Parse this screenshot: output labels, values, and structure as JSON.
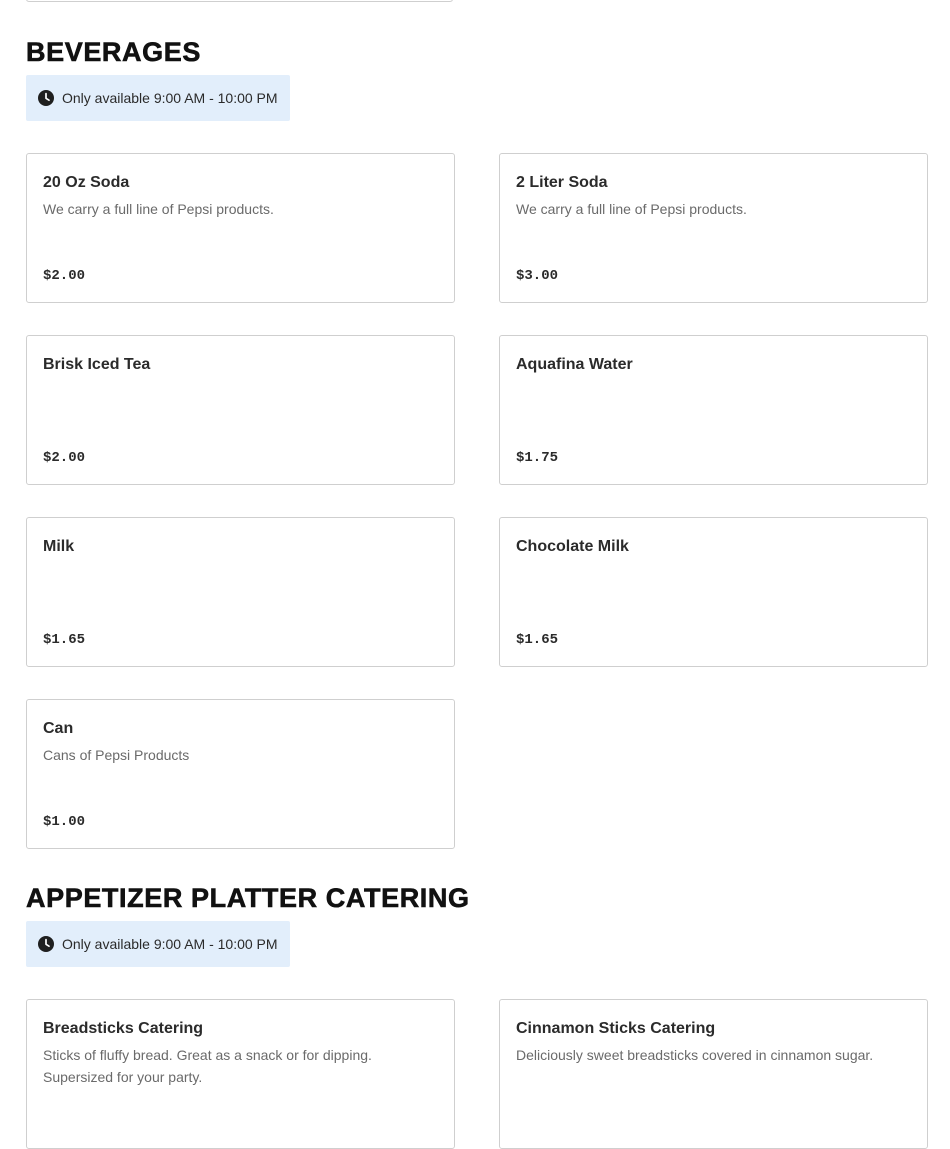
{
  "sections": [
    {
      "title": "BEVERAGES",
      "availability": "Only available 9:00 AM - 10:00 PM",
      "items": [
        {
          "name": "20 Oz Soda",
          "description": "We carry a full line of Pepsi products.",
          "price": "$2.00"
        },
        {
          "name": "2 Liter Soda",
          "description": "We carry a full line of Pepsi products.",
          "price": "$3.00"
        },
        {
          "name": "Brisk Iced Tea",
          "description": "",
          "price": "$2.00"
        },
        {
          "name": "Aquafina Water",
          "description": "",
          "price": "$1.75"
        },
        {
          "name": "Milk",
          "description": "",
          "price": "$1.65"
        },
        {
          "name": "Chocolate Milk",
          "description": "",
          "price": "$1.65"
        },
        {
          "name": "Can",
          "description": "Cans of Pepsi Products",
          "price": "$1.00"
        }
      ]
    },
    {
      "title": "APPETIZER PLATTER CATERING",
      "availability": "Only available 9:00 AM - 10:00 PM",
      "items": [
        {
          "name": "Breadsticks Catering",
          "description": "Sticks of fluffy bread. Great as a snack or for dipping. Supersized for your party.",
          "price": ""
        },
        {
          "name": "Cinnamon Sticks Catering",
          "description": "Deliciously sweet breadsticks covered in cinnamon sugar.",
          "price": ""
        }
      ]
    }
  ],
  "icons": {
    "availability": "clock-icon"
  },
  "colors": {
    "availability_bg": "#e2eefb",
    "card_border": "#cfcfcf",
    "title": "#111111"
  }
}
